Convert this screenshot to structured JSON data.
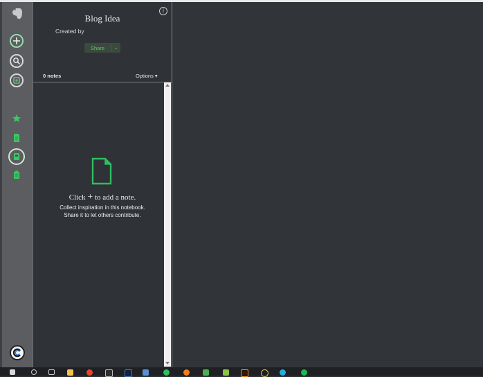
{
  "notebook": {
    "title": "Blog Idea",
    "created_by_label": "Created by",
    "share_label": "Share",
    "share_chevron": "⌄"
  },
  "list": {
    "notes_count": "0 notes",
    "options_label": "Options ▾"
  },
  "empty_state": {
    "click_text": "Click",
    "plus": "+",
    "add_text": "to add a note.",
    "line2": "Collect inspiration in this notebook.",
    "line3": "Share it to let others contribute."
  },
  "sidebar": {
    "icons": [
      "evernote-logo-icon",
      "new-note-icon",
      "search-icon",
      "work-chat-icon",
      "shortcuts-star-icon",
      "notes-icon",
      "notebooks-icon",
      "tags-icon",
      "account-avatar-icon"
    ]
  },
  "colors": {
    "accent": "#2dbe60",
    "sidebar_bg": "#5b5d61",
    "panel_bg": "#2f3236"
  },
  "taskbar": {
    "app_icons": [
      "start-icon",
      "search-icon",
      "task-view-icon",
      "file-explorer-icon",
      "chrome-icon",
      "app-icon",
      "photoshop-icon",
      "app-icon",
      "app-icon",
      "evernote-icon",
      "app-icon",
      "firefox-icon",
      "app-icon",
      "app-icon",
      "app-icon",
      "app-icon",
      "illustrator-icon",
      "app-icon",
      "app-icon",
      "app-icon",
      "app-icon"
    ]
  }
}
